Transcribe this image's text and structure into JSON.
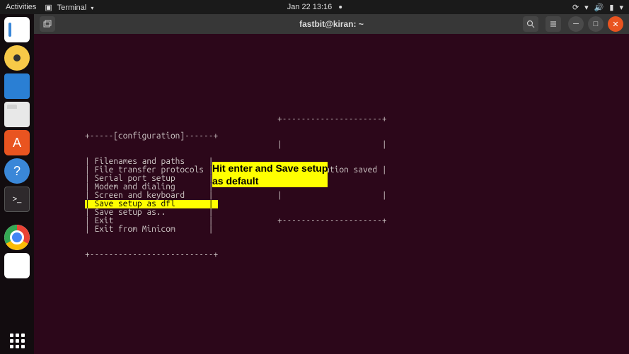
{
  "topbar": {
    "activities": "Activities",
    "app": "Terminal",
    "datetime": "Jan 22  13:16"
  },
  "window": {
    "title": "fastbit@kiran: ~"
  },
  "menu": {
    "header": "+-----[configuration]------+",
    "footer": "+--------------------------+",
    "items": [
      "Filenames and paths",
      "File transfer protocols",
      "Serial port setup",
      "Modem and dialing",
      "Screen and keyboard",
      "Save setup as dfl",
      "Save setup as..",
      "Exit",
      "Exit from Minicom"
    ],
    "selected_index": 5
  },
  "saved": {
    "border_top": "+---------------------+",
    "empty": "|                     |",
    "message": "| Configuration saved |",
    "border_bottom": "+---------------------+"
  },
  "annotation": {
    "line1": "Hit enter and Save setup",
    "line2": "as default"
  },
  "dock": {
    "items": [
      "text-editor-icon",
      "rhythmbox-icon",
      "libreoffice-writer-icon",
      "files-icon",
      "software-center-icon",
      "help-icon",
      "terminal-icon",
      "chrome-icon",
      "wps-icon"
    ]
  }
}
